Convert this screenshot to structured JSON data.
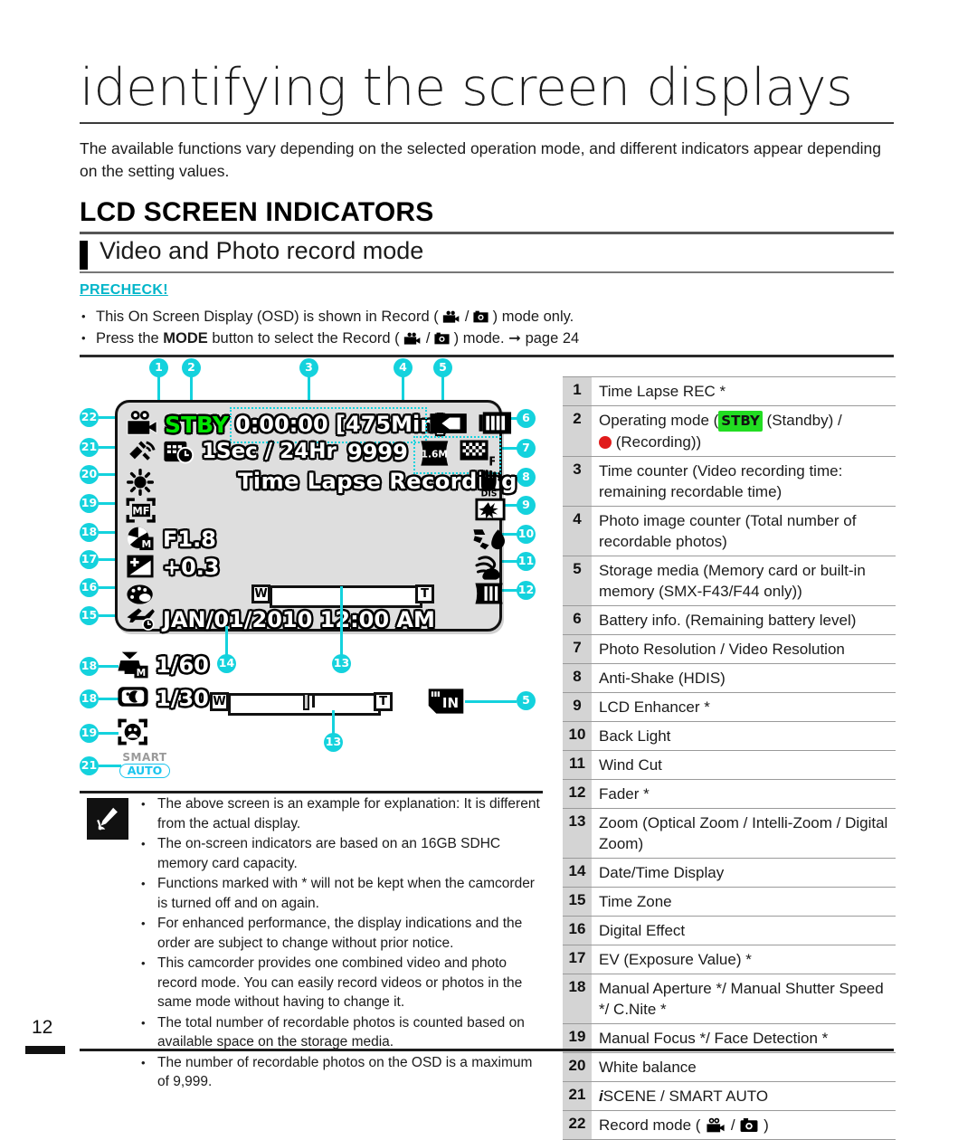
{
  "header": {
    "title": "identifying the screen displays",
    "intro": "The available functions vary depending on the selected operation mode, and different indicators appear depending on the setting values.",
    "section_title": "LCD SCREEN INDICATORS",
    "subsection_title": "Video and Photo record mode",
    "precheck_label": "PRECHECK!",
    "precheck_items": [
      "This On Screen Display (OSD) is shown in Record (  /  ) mode only.",
      "Press the MODE button to select the Record (  /  ) mode.  page 24"
    ],
    "precheck_1_a": "This On Screen Display (OSD) is shown in Record (",
    "precheck_1_b": " / ",
    "precheck_1_c": ") mode only.",
    "precheck_2_a": "Press the ",
    "precheck_2_mode": "MODE",
    "precheck_2_b": " button to select the Record (",
    "precheck_2_c": " / ",
    "precheck_2_d": " ) mode. ",
    "precheck_2_page": "page 24"
  },
  "lcd": {
    "operating_mode": "STBY",
    "time_counter": "0:00:00 [475Min]",
    "time_lapse_interval": "1Sec / 24Hr",
    "photo_counter": "9999",
    "photo_resolution": "1.6M",
    "banner": "Time Lapse Recording",
    "aperture": "F1.8",
    "ev": "+0.3",
    "datetime": "JAN/01/2010 12:00 AM",
    "shutter_speed": "1/60",
    "cnite": "1/30",
    "smart_label": "SMART",
    "auto_label": "AUTO",
    "storage_in": "IN",
    "zoom_wide": "W",
    "zoom_tele": "T",
    "dis_label": "DIS",
    "res_f": "F",
    "aperture_m": "M",
    "shutter_m": "M",
    "mf_label": "MF"
  },
  "callouts": {
    "c1": "1",
    "c2": "2",
    "c3": "3",
    "c4": "4",
    "c5": "5",
    "c6": "6",
    "c7": "7",
    "c8": "8",
    "c9": "9",
    "c10": "10",
    "c11": "11",
    "c12": "12",
    "c13": "13",
    "c14": "14",
    "c15": "15",
    "c16": "16",
    "c17": "17",
    "c18": "18",
    "c19": "19",
    "c20": "20",
    "c21": "21",
    "c22": "22",
    "c5b": "5",
    "c13b": "13",
    "c18b": "18",
    "c19b": "19",
    "c21b": "21"
  },
  "table": {
    "rows": [
      {
        "num": "1",
        "text": "Time Lapse REC *"
      },
      {
        "num": "2",
        "text": "",
        "special": "operating_mode"
      },
      {
        "num": "3",
        "text": "Time counter (Video recording time: remaining recordable time)"
      },
      {
        "num": "4",
        "text": "Photo image counter (Total number of recordable photos)"
      },
      {
        "num": "5",
        "text": "Storage media (Memory card or built-in memory (SMX-F43/F44 only))"
      },
      {
        "num": "6",
        "text": "Battery info. (Remaining battery level)"
      },
      {
        "num": "7",
        "text": "Photo Resolution / Video Resolution"
      },
      {
        "num": "8",
        "text": "Anti-Shake (HDIS)"
      },
      {
        "num": "9",
        "text": "LCD Enhancer *"
      },
      {
        "num": "10",
        "text": "Back Light"
      },
      {
        "num": "11",
        "text": "Wind Cut"
      },
      {
        "num": "12",
        "text": "Fader *"
      },
      {
        "num": "13",
        "text": "Zoom (Optical Zoom / Intelli-Zoom / Digital Zoom)"
      },
      {
        "num": "14",
        "text": "Date/Time Display"
      },
      {
        "num": "15",
        "text": "Time Zone"
      },
      {
        "num": "16",
        "text": "Digital Effect"
      },
      {
        "num": "17",
        "text": "EV (Exposure Value) *"
      },
      {
        "num": "18",
        "text": "Manual Aperture */ Manual Shutter Speed */ C.Nite *"
      },
      {
        "num": "19",
        "text": "Manual Focus */ Face Detection *"
      },
      {
        "num": "20",
        "text": "White balance"
      },
      {
        "num": "21",
        "text": "",
        "special": "iscene"
      },
      {
        "num": "22",
        "text": "",
        "special": "record_mode"
      }
    ],
    "row2_a": "Operating mode (",
    "row2_stby": "STBY",
    "row2_b": " (Standby) /",
    "row2_c": " (Recording))",
    "row21_i": "i",
    "row21_rest": "SCENE / SMART AUTO",
    "row22_a": "Record mode ( ",
    "row22_b": " / ",
    "row22_c": " )"
  },
  "notes": [
    "The above screen is an example for explanation: It is different from the actual display.",
    "The on-screen indicators are based on an 16GB SDHC memory card capacity.",
    "Functions marked with * will not be kept when the camcorder is turned off and on again.",
    "For enhanced performance, the display indications and the order are subject to change without prior notice.",
    "This camcorder provides one combined video and photo record mode. You can easily record videos or photos in the same mode without having to change it.",
    "The total number of recordable photos is counted based on available space on the storage media.",
    "The number of recordable photos on the OSD is a maximum of 9,999."
  ],
  "footer": {
    "page_number": "12"
  },
  "colors": {
    "accent_cyan": "#14d2dd",
    "stby_green": "#00e400",
    "rec_red": "#e01b1b",
    "precheck_cyan": "#00b5c9",
    "lcd_bg": "#dedede"
  }
}
